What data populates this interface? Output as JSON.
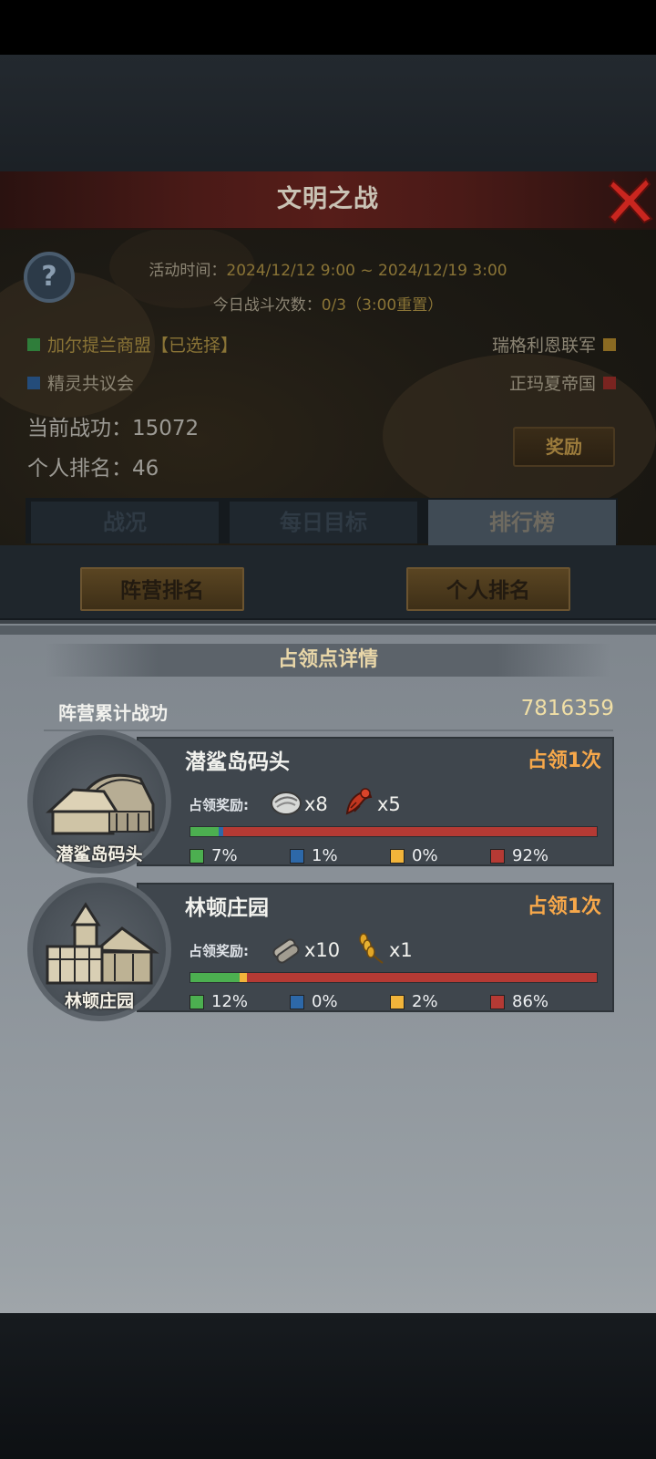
{
  "window": {
    "title": "文明之战"
  },
  "event": {
    "time_label": "活动时间：",
    "time_value": "2024/12/12 9:00 ~ 2024/12/19 3:00",
    "battles_label": "今日战斗次数：",
    "battles_value": "0/3（3:00重置）"
  },
  "factions": [
    {
      "name": "加尔提兰商盟【已选择】",
      "color": "#2f7d3a"
    },
    {
      "name": "瑞格利恩联军",
      "color": "#8a6a22"
    },
    {
      "name": "精灵共议会",
      "color": "#244c7a"
    },
    {
      "name": "正玛夏帝国",
      "color": "#7a2420"
    }
  ],
  "stats": {
    "merit_label": "当前战功：",
    "merit_value": "15072",
    "rank_label": "个人排名：",
    "rank_value": "46"
  },
  "reward_button": "奖励",
  "tabs": [
    {
      "label": "战况",
      "active": false
    },
    {
      "label": "每日目标",
      "active": false
    },
    {
      "label": "排行榜",
      "active": true
    }
  ],
  "sub_buttons": [
    "阵营排名",
    "个人排名"
  ],
  "popup": {
    "title": "占领点详情",
    "total_label": "阵营累计战功",
    "total_value": "7816359",
    "points": [
      {
        "name": "潜鲨岛码头",
        "occupied": "占领1次",
        "reward_label": "占领奖励:",
        "rewards": [
          {
            "icon": "oyster-icon",
            "qty": "x8"
          },
          {
            "icon": "lobster-icon",
            "qty": "x5"
          }
        ],
        "shares": [
          {
            "color": "#4caf50",
            "percent": 7,
            "label": "7%"
          },
          {
            "color": "#2d68a8",
            "percent": 1,
            "label": "1%"
          },
          {
            "color": "#f2b43a",
            "percent": 0,
            "label": "0%"
          },
          {
            "color": "#b53a34",
            "percent": 92,
            "label": "92%"
          }
        ]
      },
      {
        "name": "林顿庄园",
        "occupied": "占领1次",
        "reward_label": "占领奖励:",
        "rewards": [
          {
            "icon": "cloth-roll-icon",
            "qty": "x10"
          },
          {
            "icon": "wheat-icon",
            "qty": "x1"
          }
        ],
        "shares": [
          {
            "color": "#4caf50",
            "percent": 12,
            "label": "12%"
          },
          {
            "color": "#2d68a8",
            "percent": 0,
            "label": "0%"
          },
          {
            "color": "#f2b43a",
            "percent": 2,
            "label": "2%"
          },
          {
            "color": "#b53a34",
            "percent": 86,
            "label": "86%"
          }
        ]
      }
    ]
  }
}
